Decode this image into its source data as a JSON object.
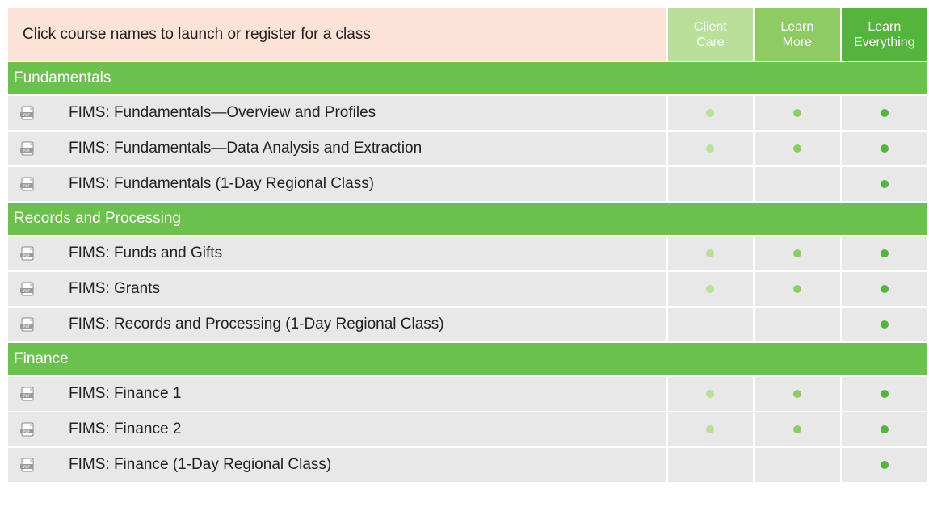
{
  "header": {
    "instruction": "Click course names to launch or register for a class",
    "tiers": [
      {
        "line1": "Client",
        "line2": "Care"
      },
      {
        "line1": "Learn",
        "line2": "More"
      },
      {
        "line1": "Learn",
        "line2": "Everything"
      }
    ]
  },
  "colors": {
    "tier1": "#b8e09a",
    "tier2": "#8ccc63",
    "tier3": "#55b43c",
    "section_bg": "#6cc04d",
    "header_bg": "#fbe3d7",
    "row_bg": "#e8e8e8"
  },
  "sections": [
    {
      "title": "Fundamentals",
      "courses": [
        {
          "name": "FIMS: Fundamentals—Overview and Profiles",
          "icon": "pdf-icon",
          "tiers": [
            true,
            true,
            true
          ]
        },
        {
          "name": "FIMS: Fundamentals—Data Analysis and Extraction",
          "icon": "pdf-icon",
          "tiers": [
            true,
            true,
            true
          ]
        },
        {
          "name": "FIMS: Fundamentals (1-Day Regional Class)",
          "icon": "pdf-icon",
          "tiers": [
            false,
            false,
            true
          ]
        }
      ]
    },
    {
      "title": "Records and Processing",
      "courses": [
        {
          "name": "FIMS: Funds and Gifts",
          "icon": "pdf-icon",
          "tiers": [
            true,
            true,
            true
          ]
        },
        {
          "name": "FIMS: Grants",
          "icon": "pdf-icon",
          "tiers": [
            true,
            true,
            true
          ]
        },
        {
          "name": "FIMS: Records and Processing (1-Day Regional Class)",
          "icon": "pdf-icon",
          "tiers": [
            false,
            false,
            true
          ]
        }
      ]
    },
    {
      "title": "Finance",
      "courses": [
        {
          "name": "FIMS: Finance 1",
          "icon": "pdf-icon",
          "tiers": [
            true,
            true,
            true
          ]
        },
        {
          "name": "FIMS: Finance 2",
          "icon": "pdf-icon",
          "tiers": [
            true,
            true,
            true
          ]
        },
        {
          "name": "FIMS: Finance (1-Day Regional Class)",
          "icon": "pdf-icon",
          "tiers": [
            false,
            false,
            true
          ]
        }
      ]
    }
  ]
}
